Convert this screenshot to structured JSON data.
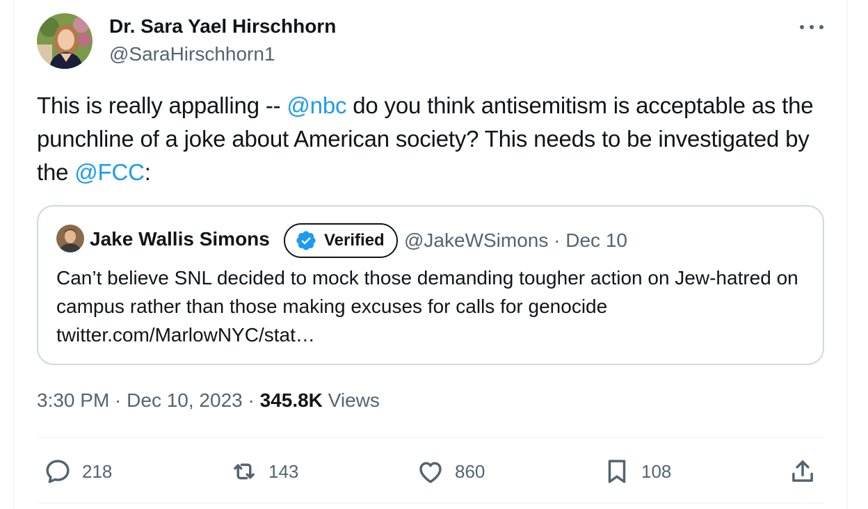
{
  "author": {
    "name": "Dr. Sara Yael Hirschhorn",
    "handle": "@SaraHirschhorn1"
  },
  "tweet": {
    "text_1": "This is really appalling -- ",
    "mention_1": "@nbc",
    "text_2": " do you think antisemitism is acceptable as the punchline of a joke about American society?  This needs to be investigated by the ",
    "mention_2": "@FCC",
    "text_3": ":"
  },
  "quote": {
    "name": "Jake Wallis Simons",
    "verified_label": "Verified",
    "meta": "@JakeWSimons · Dec 10",
    "text": "Can’t believe SNL decided to mock those demanding tougher action on Jew-hatred on campus rather than those making excuses for calls for genocide twitter.com/MarlowNYC/stat…"
  },
  "info": {
    "time": "3:30 PM · Dec 10, 2023 · ",
    "views_count": "345.8K",
    "views_label": " Views"
  },
  "actions": {
    "replies": "218",
    "reposts": "143",
    "likes": "860",
    "bookmarks": "108"
  },
  "icons": [
    "more-icon",
    "verified-badge-icon",
    "reply-icon",
    "repost-icon",
    "like-icon",
    "bookmark-icon",
    "share-icon"
  ],
  "colors": {
    "link": "#1d9bf0",
    "text": "#0f1419",
    "muted": "#536471",
    "border": "#cfd9de"
  }
}
